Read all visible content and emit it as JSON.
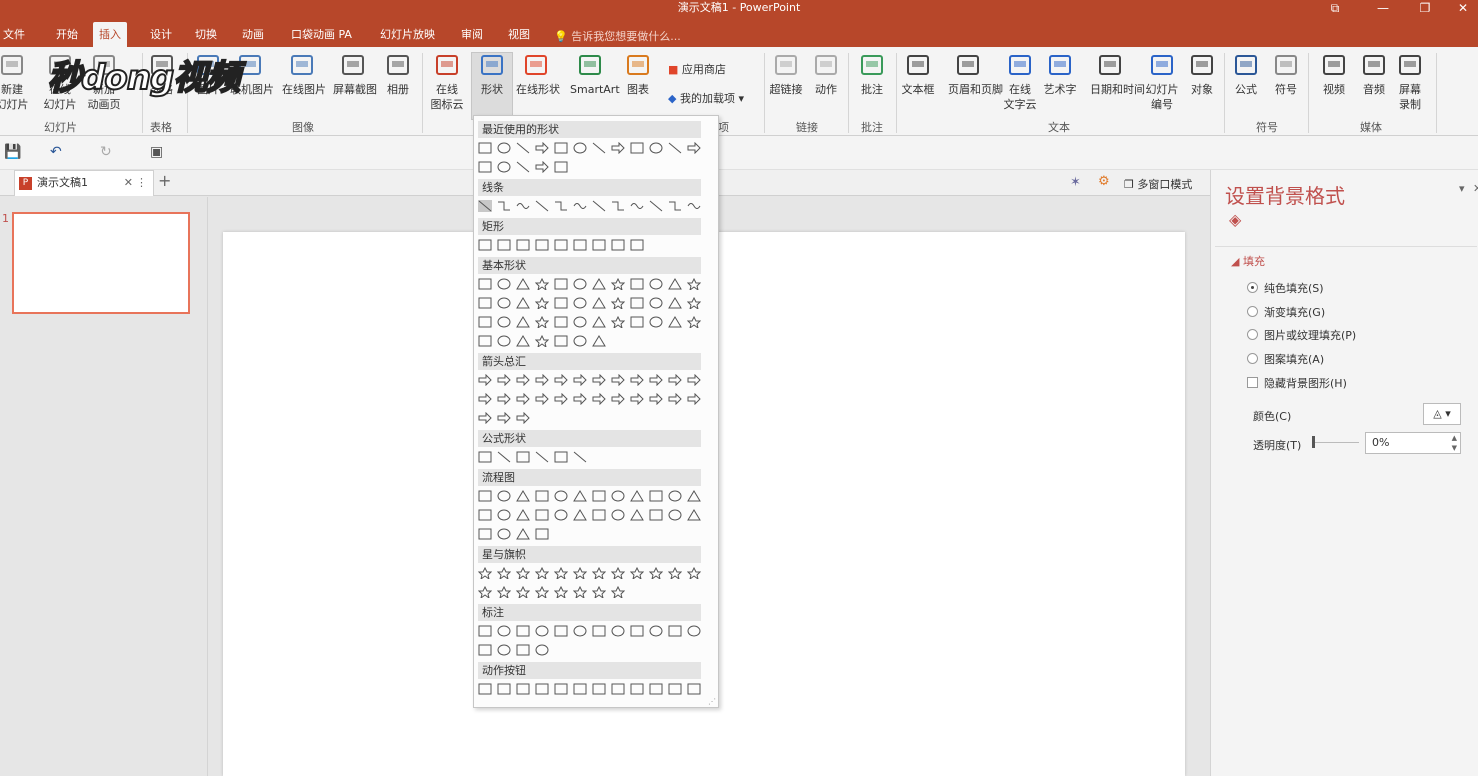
{
  "window": {
    "title": "演示文稿1 - PowerPoint",
    "controls": [
      "⧉",
      "—",
      "❐",
      "✕"
    ]
  },
  "tabs": [
    "文件",
    "开始",
    "插入",
    "设计",
    "切换",
    "动画",
    "口袋动画 PA",
    "幻灯片放映",
    "审阅",
    "视图"
  ],
  "tell_me": "告诉我您想要做什么...",
  "ribbon": {
    "buttons": [
      {
        "label": "新建",
        "label2": "幻灯片",
        "icon": "new-slide-icon"
      },
      {
        "label": "在线",
        "label2": "幻灯片",
        "icon": "online-slide-icon"
      },
      {
        "label": "新加",
        "label2": "动画页",
        "icon": "new-anim-page-icon"
      },
      {
        "label": "表格",
        "label2": "",
        "icon": "table-icon"
      },
      {
        "label": "图片",
        "label2": "",
        "icon": "picture-icon"
      },
      {
        "label": "联机图片",
        "label2": "",
        "icon": "online-picture-icon"
      },
      {
        "label": "在线图片",
        "label2": "",
        "icon": "online-image-icon"
      },
      {
        "label": "屏幕截图",
        "label2": "",
        "icon": "screenshot-icon"
      },
      {
        "label": "相册",
        "label2": "",
        "icon": "album-icon"
      },
      {
        "label": "在线",
        "label2": "图标云",
        "icon": "icon-cloud-icon"
      },
      {
        "label": "形状",
        "label2": "",
        "icon": "shapes-icon"
      },
      {
        "label": "在线形状",
        "label2": "",
        "icon": "online-shapes-icon"
      },
      {
        "label": "SmartArt",
        "label2": "",
        "icon": "smartart-icon"
      },
      {
        "label": "图表",
        "label2": "",
        "icon": "chart-icon"
      },
      {
        "label": "超链接",
        "label2": "",
        "icon": "hyperlink-icon"
      },
      {
        "label": "动作",
        "label2": "",
        "icon": "action-icon"
      },
      {
        "label": "批注",
        "label2": "",
        "icon": "comment-icon"
      },
      {
        "label": "文本框",
        "label2": "",
        "icon": "textbox-icon"
      },
      {
        "label": "页眉和页脚",
        "label2": "",
        "icon": "header-footer-icon"
      },
      {
        "label": "在线",
        "label2": "文字云",
        "icon": "word-cloud-icon"
      },
      {
        "label": "艺术字",
        "label2": "",
        "icon": "wordart-icon"
      },
      {
        "label": "日期和时间",
        "label2": "",
        "icon": "datetime-icon"
      },
      {
        "label": "幻灯片",
        "label2": "编号",
        "icon": "slide-number-icon"
      },
      {
        "label": "对象",
        "label2": "",
        "icon": "object-icon"
      },
      {
        "label": "公式",
        "label2": "",
        "icon": "equation-icon"
      },
      {
        "label": "符号",
        "label2": "",
        "icon": "symbol-icon"
      },
      {
        "label": "视频",
        "label2": "",
        "icon": "video-icon"
      },
      {
        "label": "音频",
        "label2": "",
        "icon": "audio-icon"
      },
      {
        "label": "屏幕",
        "label2": "录制",
        "icon": "screen-record-icon"
      }
    ],
    "store": {
      "app_store": "应用商店",
      "my_addins": "我的加载项"
    },
    "groups": [
      "幻灯片",
      "表格",
      "图像",
      "项",
      "链接",
      "批注",
      "文本",
      "符号",
      "媒体"
    ]
  },
  "watermark": "秒dong视频",
  "qat": {
    "save": "💾",
    "undo": "↶",
    "redo": "↻",
    "present": "▣"
  },
  "doc_tab": {
    "name": "演示文稿1",
    "close": "✕",
    "more": "⋮",
    "add": "+"
  },
  "view_tools": {
    "multi_window": "多窗口模式"
  },
  "slide": {
    "number": "1"
  },
  "shapes_menu": {
    "sections": [
      "最近使用的形状",
      "线条",
      "矩形",
      "基本形状",
      "箭头总汇",
      "公式形状",
      "流程图",
      "星与旗帜",
      "标注",
      "动作按钮"
    ],
    "counts": [
      [
        12,
        5
      ],
      [
        12
      ],
      [
        9
      ],
      [
        12,
        12,
        12,
        7
      ],
      [
        12,
        12,
        3
      ],
      [
        6
      ],
      [
        12,
        12,
        4
      ],
      [
        12,
        8
      ],
      [
        12,
        4
      ],
      [
        12
      ]
    ]
  },
  "format_panel": {
    "title": "设置背景格式",
    "section": "填充",
    "options": [
      {
        "label": "纯色填充(S)",
        "selected": true
      },
      {
        "label": "渐变填充(G)",
        "selected": false
      },
      {
        "label": "图片或纹理填充(P)",
        "selected": false
      },
      {
        "label": "图案填充(A)",
        "selected": false
      }
    ],
    "hide_bg": "隐藏背景图形(H)",
    "color_label": "颜色(C)",
    "transparency_label": "透明度(T)",
    "transparency_value": "0%"
  },
  "colors": {
    "brand": "#b7472a",
    "accent": "#c0504d"
  }
}
